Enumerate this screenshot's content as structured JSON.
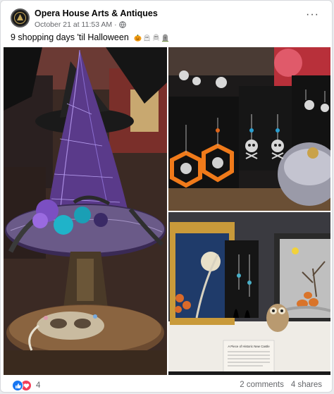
{
  "post": {
    "page_name": "Opera House Arts & Antiques",
    "date": "October 21 at 11:53 AM",
    "separator": "·",
    "text": "9 shopping days 'til Halloween",
    "emojis": [
      "pumpkin-emoji",
      "ghost-emoji",
      "skull-crossbones-emoji",
      "headstone-emoji"
    ],
    "more_label": "···"
  },
  "photos": {
    "sign_text": "A Piece of Historic New Castle"
  },
  "footer": {
    "reaction_count": "4",
    "comments": "2 comments",
    "shares": "4 shares"
  },
  "colors": {
    "accent": "#1877f2",
    "love": "#f33e58",
    "secondary_text": "#65676b"
  }
}
